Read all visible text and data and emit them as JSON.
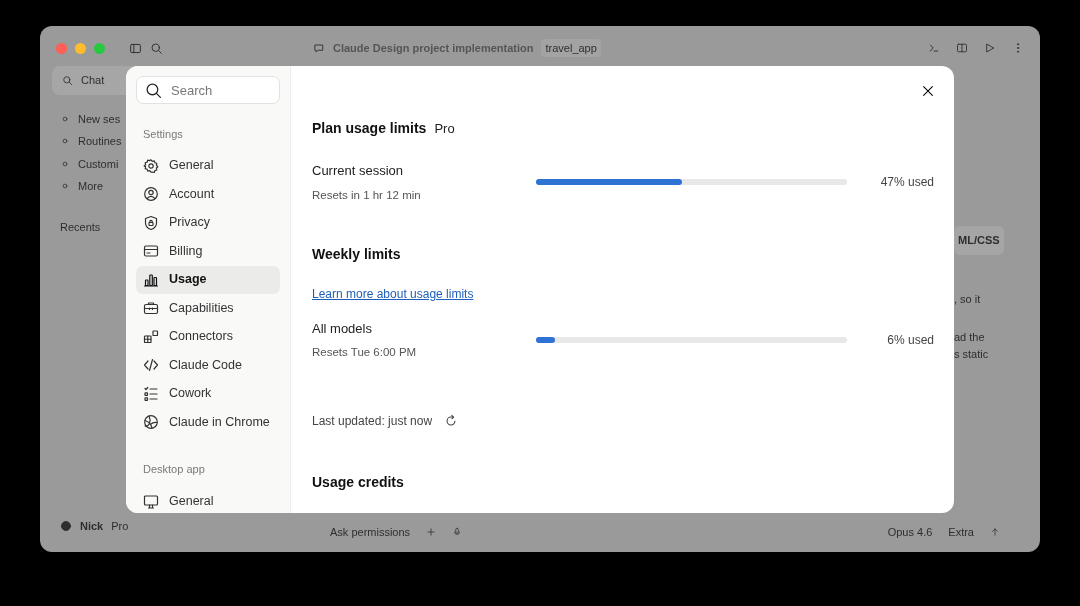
{
  "app_window": {
    "title": "Claude Design project implementation",
    "project_tag": "travel_app",
    "sidebar": {
      "chat_button": "Chat",
      "items": [
        "New ses",
        "Routines",
        "Customi",
        "More"
      ],
      "recents_heading": "Recents",
      "user": {
        "name": "Nick",
        "plan": "Pro"
      }
    },
    "conversation_fragments": [
      "ML/CSS",
      ", so it",
      "ad the",
      "s static"
    ],
    "composer": {
      "permissions": "Ask permissions",
      "model": "Opus 4.6",
      "effort": "Extra"
    }
  },
  "settings_dialog": {
    "search": {
      "placeholder": "Search"
    },
    "sections": [
      {
        "heading": "Settings",
        "items": [
          {
            "label": "General",
            "selected": false
          },
          {
            "label": "Account",
            "selected": false
          },
          {
            "label": "Privacy",
            "selected": false
          },
          {
            "label": "Billing",
            "selected": false
          },
          {
            "label": "Usage",
            "selected": true
          },
          {
            "label": "Capabilities",
            "selected": false
          },
          {
            "label": "Connectors",
            "selected": false
          },
          {
            "label": "Claude Code",
            "selected": false
          },
          {
            "label": "Cowork",
            "selected": false
          },
          {
            "label": "Claude in Chrome",
            "selected": false
          }
        ]
      },
      {
        "heading": "Desktop app",
        "items": [
          {
            "label": "General",
            "selected": false
          }
        ]
      }
    ],
    "plan": {
      "title": "Plan usage limits",
      "tier": "Pro",
      "meters": [
        {
          "name": "Current session",
          "resets": "Resets in 1 hr 12 min",
          "level": 0.47,
          "reading": "47% used"
        }
      ]
    },
    "weekly": {
      "title": "Weekly limits",
      "link": "Learn more about usage limits",
      "meters": [
        {
          "name": "All models",
          "resets": "Resets Tue 6:00 PM",
          "level": 0.06,
          "reading": "6% used"
        }
      ]
    },
    "last_updated": "Last updated: just now",
    "credits_title": "Usage credits"
  }
}
